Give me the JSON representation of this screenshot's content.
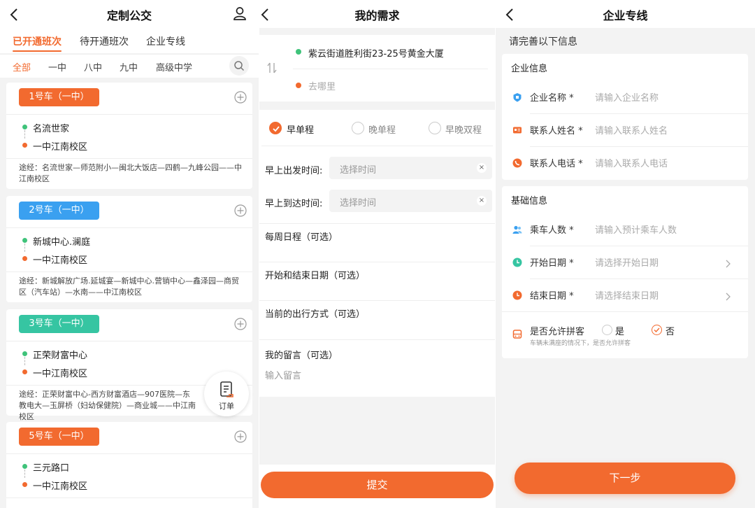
{
  "colors": {
    "accent": "#f26a2f",
    "green": "#3fc37a",
    "blue": "#3aa0f0",
    "teal": "#36c5a2"
  },
  "p1": {
    "title": "定制公交",
    "tabs": [
      "已开通班次",
      "待开通班次",
      "企业专线"
    ],
    "filters": [
      "全部",
      "一中",
      "八中",
      "九中",
      "高级中学"
    ],
    "cards": [
      {
        "tag": "1号车（一中）",
        "tag_color": "#f26a2f",
        "from": "名流世家",
        "to": "一中江南校区",
        "via": "途经：名流世家—师范附小—闽北大饭店—四鹤—九峰公园——中江南校区"
      },
      {
        "tag": "2号车（一中）",
        "tag_color": "#3aa0f0",
        "from": "新城中心.澜庭",
        "to": "一中江南校区",
        "via": "途经：新城解放广场.延城宴—新城中心.营销中心—鑫泽园—商贸区（汽车站）—水南——中江南校区"
      },
      {
        "tag": "3号车（一中）",
        "tag_color": "#36c5a2",
        "from": "正荣财富中心",
        "to": "一中江南校区",
        "via": "途经：正荣财富中心-西方财富酒店—907医院—东教电大—玉屏桥（妇幼保健院）—商业城——中江南校区"
      },
      {
        "tag": "5号车（一中）",
        "tag_color": "#f26a2f",
        "from": "三元路口",
        "to": "一中江南校区",
        "via": ""
      }
    ],
    "order_label": "订单"
  },
  "p2": {
    "title": "我的需求",
    "from_address": "紫云街道胜利街23-25号黄金大厦",
    "to_placeholder": "去哪里",
    "trip_types": [
      "早单程",
      "晚单程",
      "早晚双程"
    ],
    "selected_trip": "早单程",
    "depart_label": "早上出发时间:",
    "arrive_label": "早上到达时间:",
    "time_placeholder": "选择时间",
    "clear": "×",
    "weekly": "每周日程（可选）",
    "dates": "开始和结束日期（可选）",
    "current_mode": "当前的出行方式（可选）",
    "message": "我的留言（可选）",
    "message_placeholder": "输入留言",
    "submit": "提交"
  },
  "p3": {
    "title": "企业专线",
    "hint": "请完善以下信息",
    "company_section": "企业信息",
    "company_fields": [
      {
        "icon": "building-icon",
        "label": "企业名称 *",
        "placeholder": "请输入企业名称"
      },
      {
        "icon": "contact-card-icon",
        "label": "联系人姓名 *",
        "placeholder": "请输入联系人姓名"
      },
      {
        "icon": "phone-icon",
        "label": "联系人电话 *",
        "placeholder": "请输入联系人电话"
      }
    ],
    "basic_section": "基础信息",
    "basic_fields": [
      {
        "icon": "people-icon",
        "label": "乘车人数 *",
        "placeholder": "请输入预计乘车人数"
      },
      {
        "icon": "clock-start-icon",
        "label": "开始日期 *",
        "placeholder": "请选择开始日期"
      },
      {
        "icon": "clock-end-icon",
        "label": "结束日期 *",
        "placeholder": "请选择结束日期"
      }
    ],
    "pool_label": "是否允许拼客",
    "pool_note": "车辆未满座的情况下，是否允许拼客",
    "pool_yes": "是",
    "pool_no": "否",
    "pool_selected": "否",
    "next": "下一步"
  }
}
